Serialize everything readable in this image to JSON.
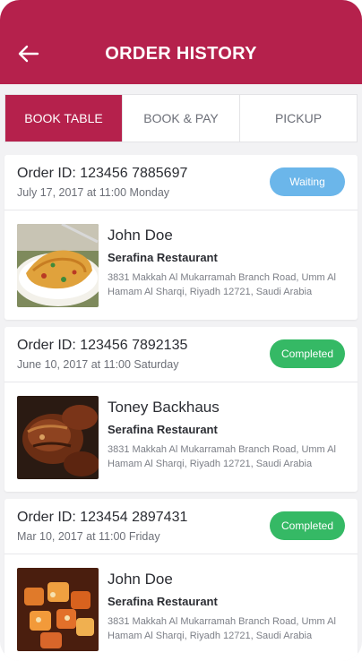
{
  "header": {
    "title": "ORDER HISTORY",
    "back_icon": "arrow-left-icon"
  },
  "tabs": [
    {
      "label": "BOOK TABLE",
      "active": true
    },
    {
      "label": "BOOK & PAY",
      "active": false
    },
    {
      "label": "PICKUP",
      "active": false
    }
  ],
  "orders": [
    {
      "order_id": "Order ID: 123456 7885697",
      "date": "July 17, 2017 at 11:00 Monday",
      "status": "Waiting",
      "name": "John Doe",
      "restaurant": "Serafina Restaurant",
      "address": "3831 Makkah Al Mukarramah Branch Road, Umm Al Hamam Al Sharqi, Riyadh 12721, Saudi Arabia",
      "image": "omelette-photo"
    },
    {
      "order_id": "Order ID: 123456 7892135",
      "date": "June 10, 2017 at 11:00 Saturday",
      "status": "Completed",
      "name": "Toney Backhaus",
      "restaurant": "Serafina Restaurant",
      "address": "3831 Makkah Al Mukarramah Branch Road, Umm Al Hamam Al Sharqi, Riyadh 12721, Saudi Arabia",
      "image": "grilled-meat-photo"
    },
    {
      "order_id": "Order ID: 123454 2897431",
      "date": "Mar 10, 2017 at 11:00 Friday",
      "status": "Completed",
      "name": "John Doe",
      "restaurant": "Serafina Restaurant",
      "address": "3831 Makkah Al Mukarramah Branch Road, Umm Al Hamam Al Sharqi, Riyadh 12721, Saudi Arabia",
      "image": "roasted-potatoes-photo"
    }
  ],
  "colors": {
    "brand": "#b5214c",
    "waiting": "#6bb6ea",
    "completed": "#35b965"
  }
}
